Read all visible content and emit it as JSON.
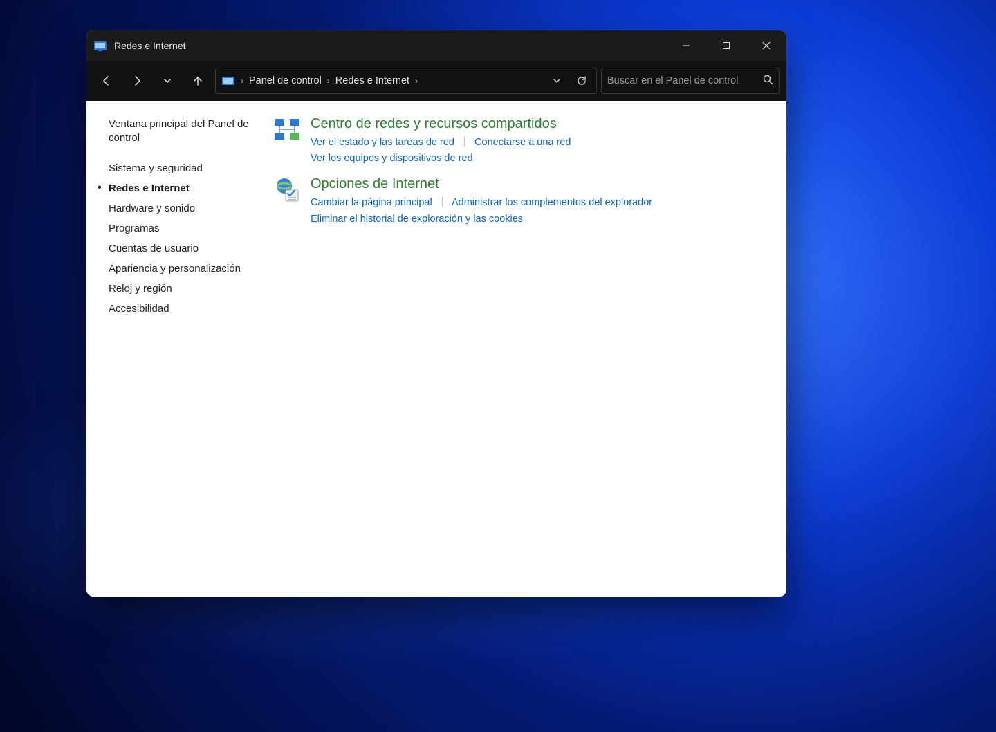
{
  "window": {
    "title": "Redes e Internet"
  },
  "breadcrumb": {
    "segments": [
      "Panel de control",
      "Redes e Internet"
    ]
  },
  "search": {
    "placeholder": "Buscar en el Panel de control"
  },
  "sidebar": {
    "home": "Ventana principal del Panel de control",
    "items": [
      "Sistema y seguridad",
      "Redes e Internet",
      "Hardware y sonido",
      "Programas",
      "Cuentas de usuario",
      "Apariencia y personalización",
      "Reloj y región",
      "Accesibilidad"
    ],
    "activeIndex": 1
  },
  "sections": [
    {
      "title": "Centro de redes y recursos compartidos",
      "row1a": "Ver el estado y las tareas de red",
      "row1b": "Conectarse a una red",
      "row2": "Ver los equipos y dispositivos de red"
    },
    {
      "title": "Opciones de Internet",
      "row1a": "Cambiar la página principal",
      "row1b": "Administrar los complementos del explorador",
      "row2": "Eliminar el historial de exploración y las cookies"
    }
  ]
}
